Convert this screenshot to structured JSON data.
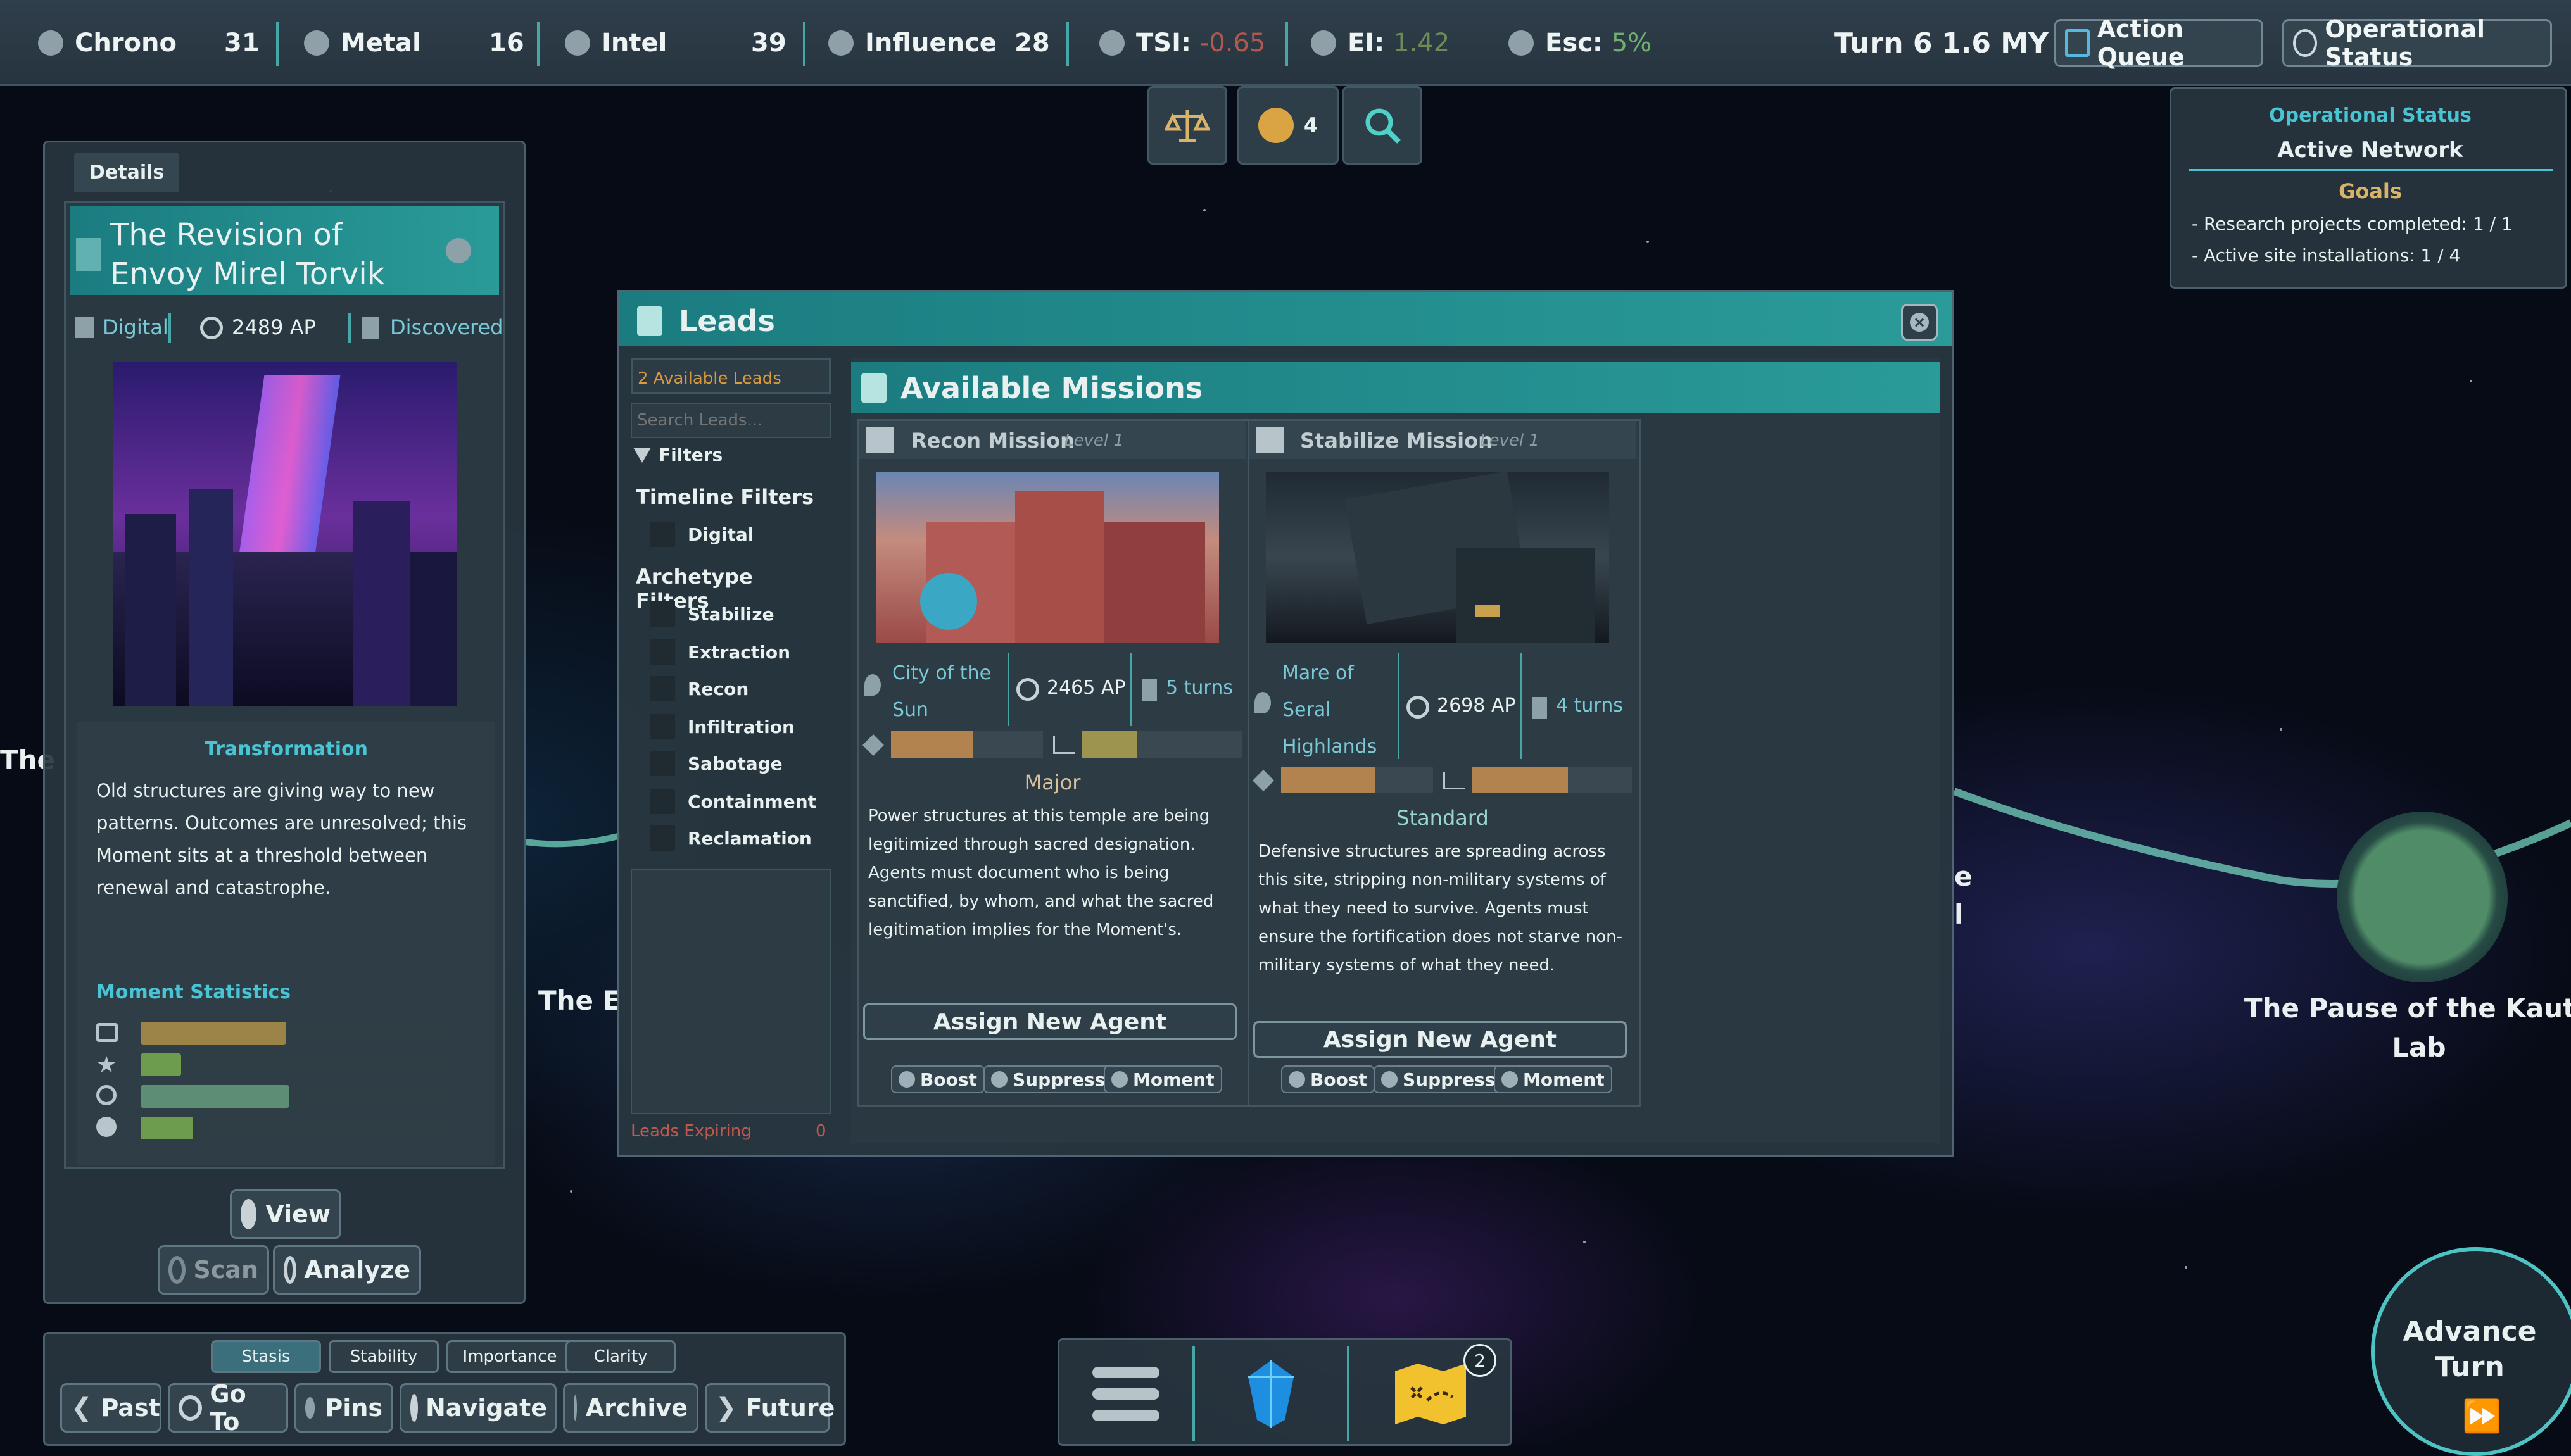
{
  "topbar": {
    "resources": [
      {
        "label": "Chrono",
        "value": "31",
        "icon": "chrono-icon"
      },
      {
        "label": "Metal",
        "value": "16",
        "icon": "metal-icon"
      },
      {
        "label": "Intel",
        "value": "39",
        "icon": "intel-icon"
      },
      {
        "label": "Influence",
        "value": "28",
        "icon": "influence-icon"
      }
    ],
    "tsi_label": "TSI:",
    "tsi_value": "-0.65",
    "ei_label": "EI:",
    "ei_value": "1.42",
    "esc_label": "Esc:",
    "esc_value": "5%",
    "turn": "Turn 6",
    "time": "1.6 MY",
    "action_queue": "Action Queue",
    "operational_status": "Operational Status"
  },
  "quick_icons": {
    "agents_count": "4"
  },
  "status_panel": {
    "title": "Operational Status",
    "subtitle": "Active Network",
    "goals_title": "Goals",
    "goals": [
      "- Research projects completed: 1 / 1",
      "- Active site installations: 1 / 4"
    ]
  },
  "details": {
    "tab": "Details",
    "title": "The Revision of Envoy Mirel Torvik",
    "tags": [
      "Digital",
      "2489 AP",
      "Discovered"
    ],
    "section_title": "Transformation",
    "description": "Old structures are giving way to new patterns. Outcomes are unresolved; this Moment sits at a threshold between renewal and catastrophe.",
    "stats_title": "Moment Statistics",
    "stats": [
      {
        "icon": "balance-icon",
        "value": 0.47,
        "color": "#9c8347"
      },
      {
        "icon": "star-icon",
        "value": 0.13,
        "color": "#6d9c4c"
      },
      {
        "icon": "search-icon",
        "value": 0.48,
        "color": "#5b8e72"
      },
      {
        "icon": "cycle-icon",
        "value": 0.17,
        "color": "#6d9c4c"
      }
    ],
    "view": "View",
    "scan": "Scan",
    "analyze": "Analyze"
  },
  "leads": {
    "title": "Leads",
    "available": "2 Available Leads",
    "search_placeholder": "Search Leads...",
    "filters": "Filters",
    "timeline_filters": "Timeline Filters",
    "timeline_items": [
      "Digital"
    ],
    "archetype_filters": "Archetype Filters",
    "archetype_items": [
      "Stabilize",
      "Extraction",
      "Recon",
      "Infiltration",
      "Sabotage",
      "Containment",
      "Reclamation"
    ],
    "expiring_label": "Leads Expiring",
    "expiring_count": "0",
    "missions_title": "Available Missions",
    "missions": [
      {
        "name": "Recon Mission",
        "level": "Level 1",
        "location": "City of the Sun",
        "ap": "2465 AP",
        "turns": "5 turns",
        "severity": "Major",
        "description": "Power structures at this temple are being legitimized through sacred designation. Agents must document who is being sanctified, by whom, and what the sacred legitimation implies for the Moment's.",
        "assign": "Assign New Agent",
        "actions": [
          "Boost",
          "Suppress",
          "Moment"
        ]
      },
      {
        "name": "Stabilize Mission",
        "level": "Level 1",
        "location": "Mare of Seral Highlands",
        "ap": "2698 AP",
        "turns": "4 turns",
        "severity": "Standard",
        "description": "Defensive structures are spreading across this site, stripping non-military systems of what they need to survive. Agents must ensure the fortification does not starve non-military systems of what they need.",
        "assign": "Assign New Agent",
        "actions": [
          "Boost",
          "Suppress",
          "Moment"
        ]
      }
    ]
  },
  "map_labels": {
    "left_edge": "The",
    "left_mid": "The E",
    "right_frag_1": "e",
    "right_frag_2": "l",
    "right_node": "The Pause of the Kauto Lab"
  },
  "bottom": {
    "tabs": [
      "Stasis",
      "Stability",
      "Importance",
      "Clarity"
    ],
    "nav": [
      "Past",
      "Go To",
      "Pins",
      "Navigate",
      "Archive",
      "Future"
    ],
    "map_badge": "2",
    "advance": "Advance Turn"
  }
}
